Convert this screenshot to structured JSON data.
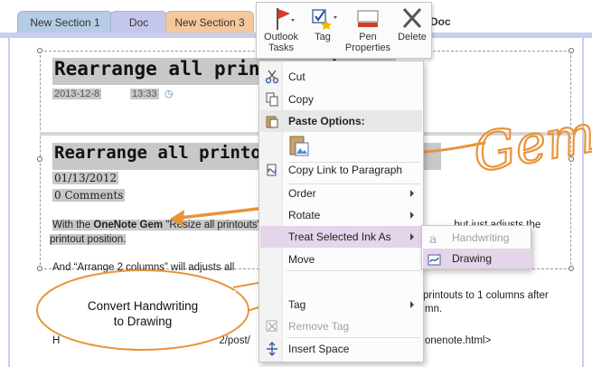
{
  "tabs": [
    {
      "label": "New Section 1"
    },
    {
      "label": "Doc"
    },
    {
      "label": "New Section 3"
    },
    {
      "label": "Doc"
    }
  ],
  "page": {
    "title1": "Rearrange all printouts in OneNote",
    "date1": "2013-12-8",
    "time1": "13:33",
    "title2": "Rearrange all printouts",
    "date2": "01/13/2012",
    "comments": "0 Comments",
    "body1_pre": "With the ",
    "body1_link": "OneNote Gem",
    "body1_post": " \"Resize all printouts\"",
    "body1_tail": ", but just adjusts the",
    "body2": "printout position.",
    "body3": "And “Arrange 2 columns” will adjusts all",
    "body4": "printouts to 1 columns after",
    "body5": "mn.",
    "body6_pre": "H",
    "body6_mid": "2/post/",
    "body7": "onenote.html>"
  },
  "ink_text": "Gem",
  "mini_toolbar": {
    "outlook_tasks": "Outlook Tasks",
    "outlook_line1": "Outlook",
    "outlook_line2": "Tasks",
    "tag": "Tag",
    "pen_line1": "Pen",
    "pen_line2": "Properties",
    "delete": "Delete"
  },
  "context_menu": {
    "cut": "Cut",
    "copy": "Copy",
    "paste_options": "Paste Options:",
    "copy_link": "Copy Link to Paragraph",
    "order": "Order",
    "rotate": "Rotate",
    "treat_ink": "Treat Selected Ink As",
    "move": "Move",
    "tag": "Tag",
    "remove_tag": "Remove Tag",
    "insert_space": "Insert Space"
  },
  "submenu": {
    "handwriting": "Handwriting",
    "drawing": "Drawing"
  },
  "callout": {
    "line1": "Convert Handwriting",
    "line2": "to Drawing"
  },
  "colors": {
    "ink_orange": "#e8943a",
    "menu_highlight": "#e5d5ea",
    "tab_blue": "#b6cbe6",
    "tab_orange": "#f4c89c",
    "tab_doc": "#c5c6ec"
  }
}
